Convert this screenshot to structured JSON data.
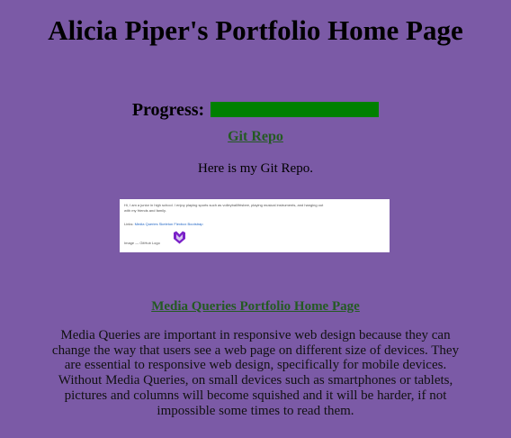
{
  "page": {
    "title": "Alicia Piper's Portfolio Home Page"
  },
  "progress": {
    "label": "Progress:",
    "value_percent": 100
  },
  "git": {
    "link_text": "Git Repo",
    "description": "Here is my Git Repo.",
    "thumbnail": {
      "bio": "Hi, I am a junior in high school. I enjoy playing sports such as volleyball/frisbee, playing musical instruments, and hanging out",
      "bio_2": "with my friends and family.",
      "links_label": "Links:",
      "links": "Media Queries  Skeleton  Flexbox  Bootstrap",
      "image_label": "Image — GitHub Logo",
      "logo_icon": "github-logo-icon"
    }
  },
  "media_queries": {
    "link_text": "Media Queries Portfolio Home Page",
    "description": "Media Queries are important in responsive web design because they can change the way that users see a web page on different size of devices. They are essential to responsive web design, specifically for mobile devices. Without Media Queries, on small devices such as smartphones or tablets, pictures and columns will become squished and it will be harder, if not impossible some times to read them."
  },
  "colors": {
    "background": "#7b5aa6",
    "progress_fill": "#008000",
    "link": "#245a22"
  }
}
